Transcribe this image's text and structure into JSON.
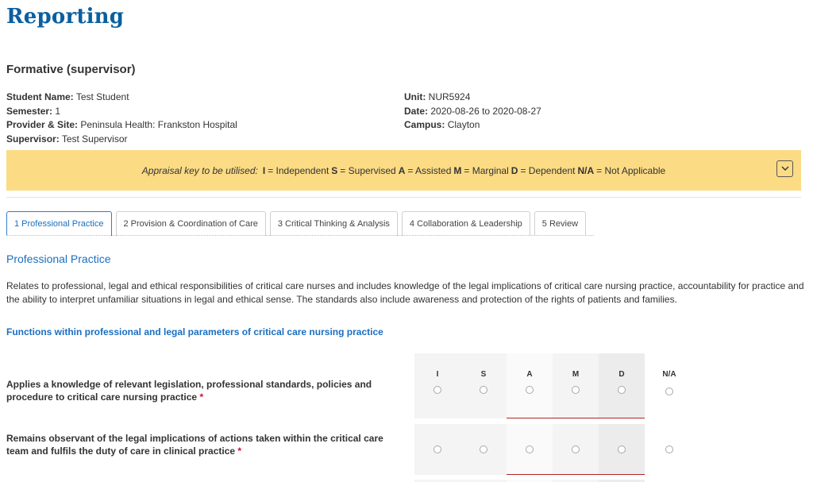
{
  "page": {
    "title": "Reporting",
    "subtitle": "Formative (supervisor)"
  },
  "meta": {
    "student_name_label": "Student Name:",
    "student_name": "Test Student",
    "semester_label": "Semester:",
    "semester": "1",
    "provider_label": "Provider & Site:",
    "provider": "Peninsula Health: Frankston Hospital",
    "supervisor_label": "Supervisor:",
    "supervisor": "Test Supervisor",
    "unit_label": "Unit:",
    "unit": "NUR5924",
    "date_label": "Date:",
    "date": "2020-08-26 to 2020-08-27",
    "campus_label": "Campus:",
    "campus": "Clayton"
  },
  "appraisal_key": {
    "lead": "Appraisal key to be utilised:",
    "items": [
      {
        "code": "I",
        "meaning": "= Independent"
      },
      {
        "code": "S",
        "meaning": "= Supervised"
      },
      {
        "code": "A",
        "meaning": "= Assisted"
      },
      {
        "code": "M",
        "meaning": "= Marginal"
      },
      {
        "code": "D",
        "meaning": "= Dependent"
      },
      {
        "code": "N/A",
        "meaning": "= Not Applicable"
      }
    ],
    "background": "#fbdb84",
    "toggle_icon": "chevron-down-icon"
  },
  "tabs": [
    {
      "label": "1  Professional Practice",
      "active": true
    },
    {
      "label": "2  Provision & Coordination of Care",
      "active": false
    },
    {
      "label": "3  Critical Thinking & Analysis",
      "active": false
    },
    {
      "label": "4  Collaboration & Leadership",
      "active": false
    },
    {
      "label": "5  Review",
      "active": false
    }
  ],
  "section": {
    "title": "Professional Practice",
    "description": "Relates to professional, legal and ethical responsibilities of critical care nurses and includes knowledge of the legal implications of critical care nursing practice, accountability for practice and the ability to interpret unfamiliar situations in legal and ethical sense. The standards also include awareness and protection of the rights of patients and families.",
    "group_title": "Functions within professional and legal parameters of critical care nursing practice"
  },
  "rating_columns": [
    "I",
    "S",
    "A",
    "M",
    "D",
    "N/A"
  ],
  "items": [
    {
      "label": "Applies a knowledge of relevant legislation, professional standards, policies and procedure to critical care nursing practice",
      "required_mark": "*"
    },
    {
      "label": "Remains observant of the legal implications of actions taken within the critical care team and fulfils the duty of care in clinical practice",
      "required_mark": "*"
    }
  ],
  "colors": {
    "accent": "#1a6fc0",
    "title": "#0a5fa0",
    "required": "#c8102e"
  }
}
